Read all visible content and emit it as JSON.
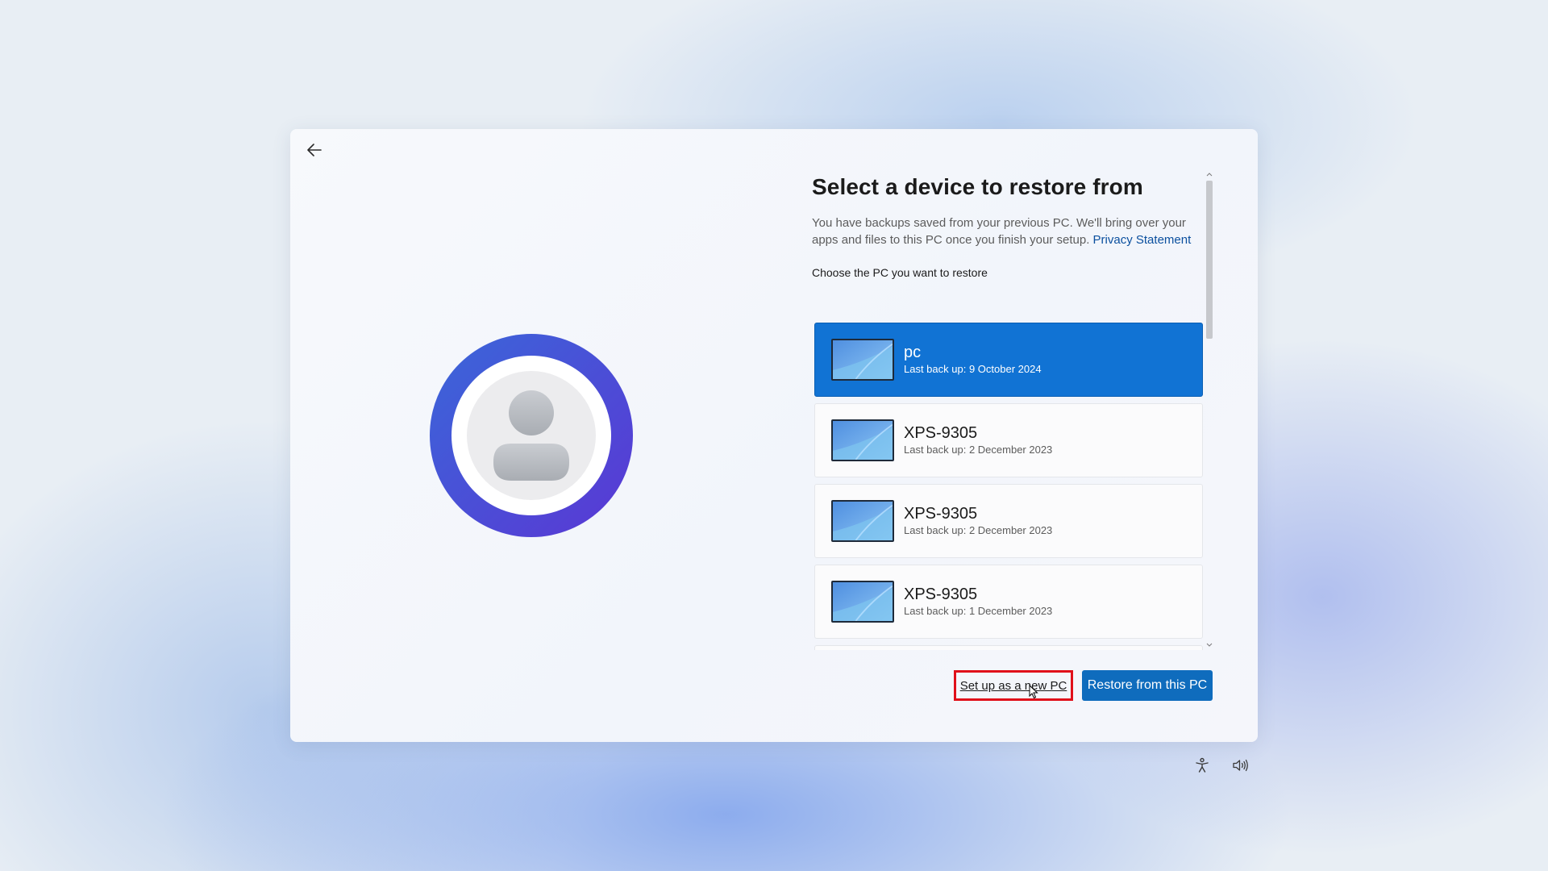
{
  "header": {
    "title": "Select a device to restore from",
    "description": "You have backups saved from your previous PC. We'll bring over your apps and files to this PC once you finish your setup.",
    "privacy_link": "Privacy Statement"
  },
  "list": {
    "label": "Choose the PC you want to restore",
    "devices": [
      {
        "name": "pc",
        "backup": "Last back up: 9 October 2024",
        "selected": true
      },
      {
        "name": "XPS-9305",
        "backup": "Last back up: 2 December 2023",
        "selected": false
      },
      {
        "name": "XPS-9305",
        "backup": "Last back up: 2 December 2023",
        "selected": false
      },
      {
        "name": "XPS-9305",
        "backup": "Last back up: 1 December 2023",
        "selected": false
      }
    ]
  },
  "buttons": {
    "setup_new": "Set up as a new PC",
    "restore": "Restore from this PC"
  },
  "icons": {
    "back": "back-arrow-icon",
    "accessibility": "accessibility-icon",
    "volume": "volume-icon"
  },
  "colors": {
    "accent": "#0f6cbd",
    "selected_row": "#1173d4",
    "highlight_border": "#e0101a",
    "avatar_ring_start": "#3d62d8",
    "avatar_ring_end": "#5b3bd6"
  }
}
